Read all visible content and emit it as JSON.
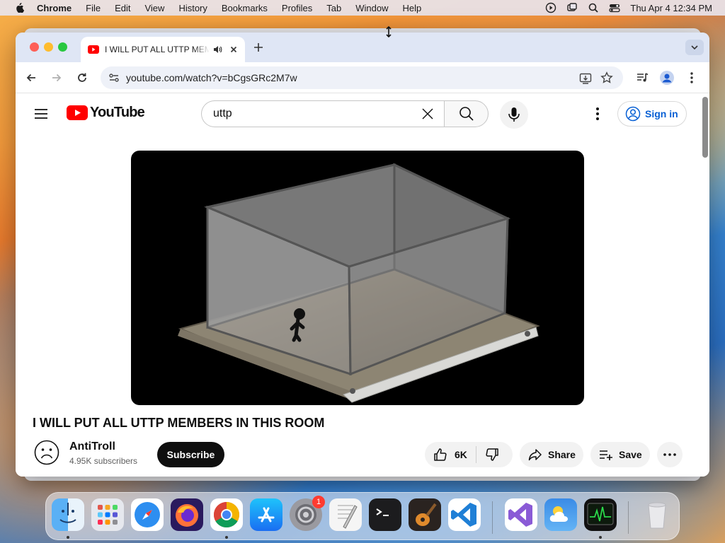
{
  "menubar": {
    "items": [
      "Chrome",
      "File",
      "Edit",
      "View",
      "History",
      "Bookmarks",
      "Profiles",
      "Tab",
      "Window",
      "Help"
    ],
    "datetime": "Thu Apr 4  12:34 PM"
  },
  "browser": {
    "tab_title": "I WILL PUT ALL UTTP MEMBERS IN THIS ROOM",
    "url": "youtube.com/watch?v=bCgsGRc2M7w"
  },
  "youtube": {
    "logo_text": "YouTube",
    "search_query": "uttp",
    "signin_label": "Sign in",
    "video_title": "I WILL PUT ALL UTTP MEMBERS IN THIS ROOM",
    "channel_name": "AntiTroll",
    "subscribers": "4.95K subscribers",
    "subscribe_label": "Subscribe",
    "likes": "6K",
    "share_label": "Share",
    "save_label": "Save"
  },
  "dock": {
    "apps": [
      "finder-icon",
      "launchpad-icon",
      "safari-icon",
      "firefox-icon",
      "chrome-icon",
      "app-store-icon",
      "system-settings-icon",
      "textedit-icon",
      "terminal-icon",
      "garageband-icon",
      "vscode-icon",
      "visual-studio-icon",
      "weather-icon",
      "activity-monitor-icon",
      "trash-icon"
    ],
    "settings_badge": "1"
  },
  "colors": {
    "youtube_red": "#ff0000",
    "link_blue": "#065fd4",
    "tab_strip": "#dfe6f5"
  }
}
